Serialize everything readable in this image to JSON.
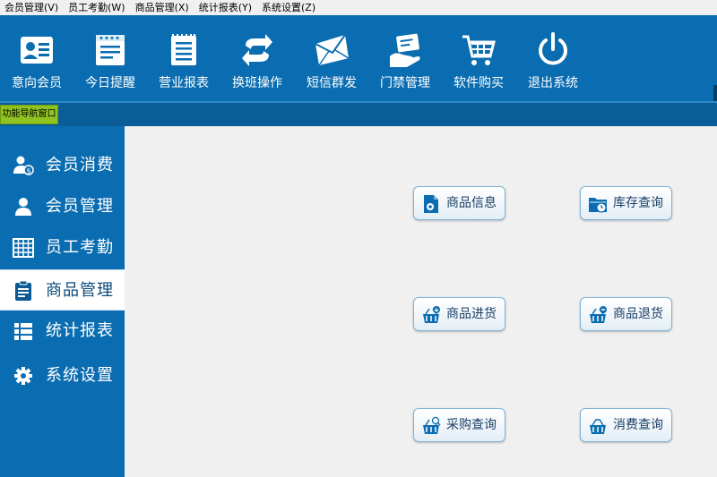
{
  "menu": [
    {
      "label": "会员管理(V)"
    },
    {
      "label": "员工考勤(W)"
    },
    {
      "label": "商品管理(X)"
    },
    {
      "label": "统计报表(Y)"
    },
    {
      "label": "系统设置(Z)"
    }
  ],
  "toolbar": [
    {
      "label": "意向会员",
      "icon": "id-card-icon"
    },
    {
      "label": "今日提醒",
      "icon": "notepad-icon"
    },
    {
      "label": "营业报表",
      "icon": "report-icon"
    },
    {
      "label": "换班操作",
      "icon": "swap-icon"
    },
    {
      "label": "短信群发",
      "icon": "envelope-icon"
    },
    {
      "label": "门禁管理",
      "icon": "card-hand-icon"
    },
    {
      "label": "软件购买",
      "icon": "cart-icon"
    },
    {
      "label": "退出系统",
      "icon": "power-icon"
    }
  ],
  "nav_tab": {
    "label": "功能导航窗口"
  },
  "sidebar": [
    {
      "label": "会员消费",
      "icon": "member-payment-icon"
    },
    {
      "label": "会员管理",
      "icon": "user-icon"
    },
    {
      "label": "员工考勤",
      "icon": "calendar-grid-icon"
    },
    {
      "label": "商品管理",
      "icon": "clipboard-icon",
      "active": true
    },
    {
      "label": "统计报表",
      "icon": "list-icon"
    },
    {
      "label": "系统设置",
      "icon": "gear-icon"
    }
  ],
  "actions": [
    {
      "label": "商品信息",
      "icon": "product-doc-icon"
    },
    {
      "label": "库存查询",
      "icon": "folder-clock-icon"
    },
    {
      "label": "商品进货",
      "icon": "basket-in-icon"
    },
    {
      "label": "商品退货",
      "icon": "basket-return-icon"
    },
    {
      "label": "采购查询",
      "icon": "basket-search-icon"
    },
    {
      "label": "消费查询",
      "icon": "basket-icon"
    }
  ],
  "colors": {
    "primary": "#0b6db1",
    "accent": "#8fc31f"
  }
}
